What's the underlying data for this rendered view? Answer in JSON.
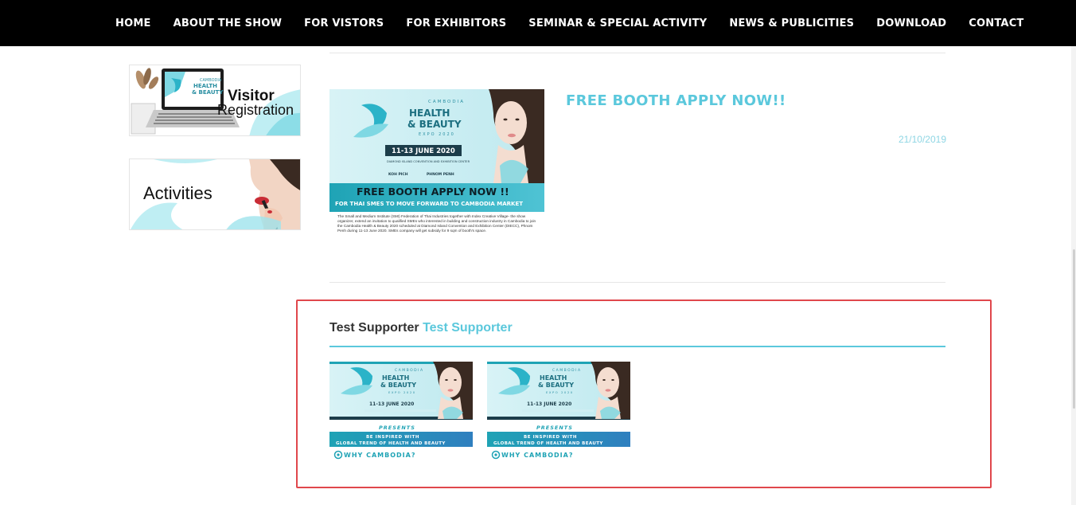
{
  "nav": {
    "items": [
      "HOME",
      "ABOUT THE SHOW",
      "FOR VISTORS",
      "FOR EXHIBITORS",
      "SEMINAR & SPECIAL ACTIVITY",
      "NEWS & PUBLICITIES",
      "DOWNLOAD",
      "CONTACT"
    ]
  },
  "sidebar": {
    "visitor": {
      "line1": "Visitor",
      "line2": "Registration",
      "laptop_text": "HEALTH & BEAUTY"
    },
    "activities": {
      "label": "Activities"
    }
  },
  "post": {
    "title": "FREE BOOTH APPLY NOW!!",
    "date": "21/10/2019",
    "image": {
      "brand_top": "CAMBODIA",
      "brand_main1": "HEALTH",
      "brand_main2": "& BEAUTY",
      "brand_sub": "EXPO 2020",
      "dates": "11-13 JUNE 2020",
      "venue": "DIAMOND ISLAND CONVENTION AND EXHIBITION CENTER",
      "city_left": "KOH PICH",
      "city_right": "PHNOM PENH",
      "banner_main": "FREE  BOOTH APPLY NOW !!",
      "banner_sub": "FOR THAI SMES TO MOVE FORWARD TO CAMBODIA MARKET",
      "body": "The Small and Medium Institute (SMI) Federation of Thai Industries together with Index Creative Village- the show organizer, extend an invitation to qualified SMEs who interested in building and construction industry in Cambodia to join the Cambodia Health & Beauty 2020 scheduled at Diamond Island Convention and Exhibition Center (DIECC), Phnom Penh during 11-13 June 2020. SMEs company will get subsidy for 9 sqm of booth's space."
    }
  },
  "supporter": {
    "title_dark": "Test Supporter",
    "title_accent": "Test Supporter",
    "logo": {
      "brand_top": "CAMBODIA",
      "brand_main1": "HEALTH",
      "brand_main2": "& BEAUTY",
      "brand_sub": "EXPO 2020",
      "dates": "11-13 JUNE 2020",
      "presents": "PRESENTS",
      "line1": "BE INSPIRED WITH",
      "line2": "GLOBAL TREND OF HEALTH AND BEAUTY",
      "why": "WHY CAMBODIA?"
    }
  },
  "colors": {
    "accent": "#5bc8dc",
    "nav_bg": "#000000",
    "highlight": "#e0474c",
    "teal_banner": "#1fa3b5"
  }
}
